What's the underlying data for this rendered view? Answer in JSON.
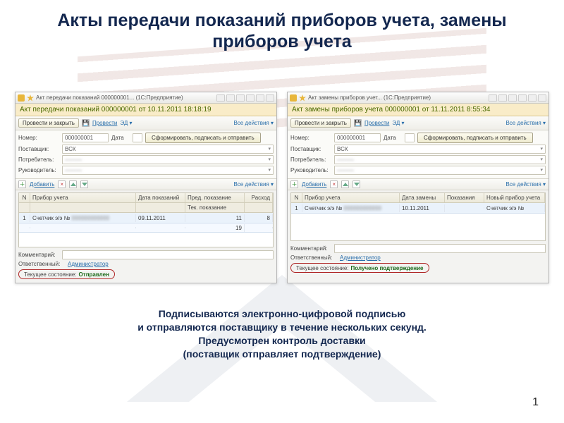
{
  "slide": {
    "title": "Акты передачи показаний приборов учета, замены приборов учета",
    "caption_l1": "Подписываются электронно-цифровой подписью",
    "caption_l2": "и отправляются поставщику в течение нескольких секунд.",
    "caption_l3": "Предусмотрен контроль доставки",
    "caption_l4": "(поставщик отправляет подтверждение)",
    "page_number": "1"
  },
  "common": {
    "process_close": "Провести и закрыть",
    "process": "Провести",
    "ed_link": "ЭД ▾",
    "all_actions": "Все действия ▾",
    "add": "Добавить",
    "number_lbl": "Номер:",
    "date_lbl": "Дата",
    "supplier_lbl": "Поставщик:",
    "consumer_lbl": "Потребитель:",
    "manager_lbl": "Руководитель:",
    "comment_lbl": "Комментарий:",
    "responsible_lbl": "Ответственный:",
    "responsible_val": "Администратор",
    "status_lbl": "Текущее состояние:",
    "big_btn": "Сформировать, подписать и отправить"
  },
  "left": {
    "tb_title": "Акт передачи показаний 000000001... (1С:Предприятие)",
    "ribbon": "Акт передачи показаний 000000001 от 10.11.2011 18:18:19",
    "number": "000000001",
    "date": "",
    "supplier": "ВСК",
    "consumer": "———",
    "manager": "———",
    "grid_head": {
      "n": "N",
      "device": "Прибор учета",
      "date": "Дата показаний",
      "prev": "Пред. показание",
      "cur": "Тек. показание",
      "cons": "Расход"
    },
    "row": {
      "n": "1",
      "device": "Счетчик э/э №",
      "dev_blur": "000000000000",
      "date": "09.11.2011",
      "prev": "11",
      "cur": "19",
      "cons": "8"
    },
    "status_val": "Отправлен"
  },
  "right": {
    "tb_title": "Акт замены приборов учет... (1С:Предприятие)",
    "ribbon": "Акт замены приборов учета 000000001 от 11.11.2011 8:55:34",
    "number": "000000001",
    "date": "",
    "supplier": "ВСК",
    "consumer": "———",
    "manager": "———",
    "grid_head": {
      "n": "N",
      "device": "Прибор учета",
      "date": "Дата замены",
      "read": "Показания",
      "new": "Новый прибор учета"
    },
    "row": {
      "n": "1",
      "device": "Счетчик э/э №",
      "dev_blur": "000000000000",
      "date": "10.11.2011",
      "read": "",
      "new": "Счетчик э/э №"
    },
    "status_val": "Получено подтверждение"
  }
}
